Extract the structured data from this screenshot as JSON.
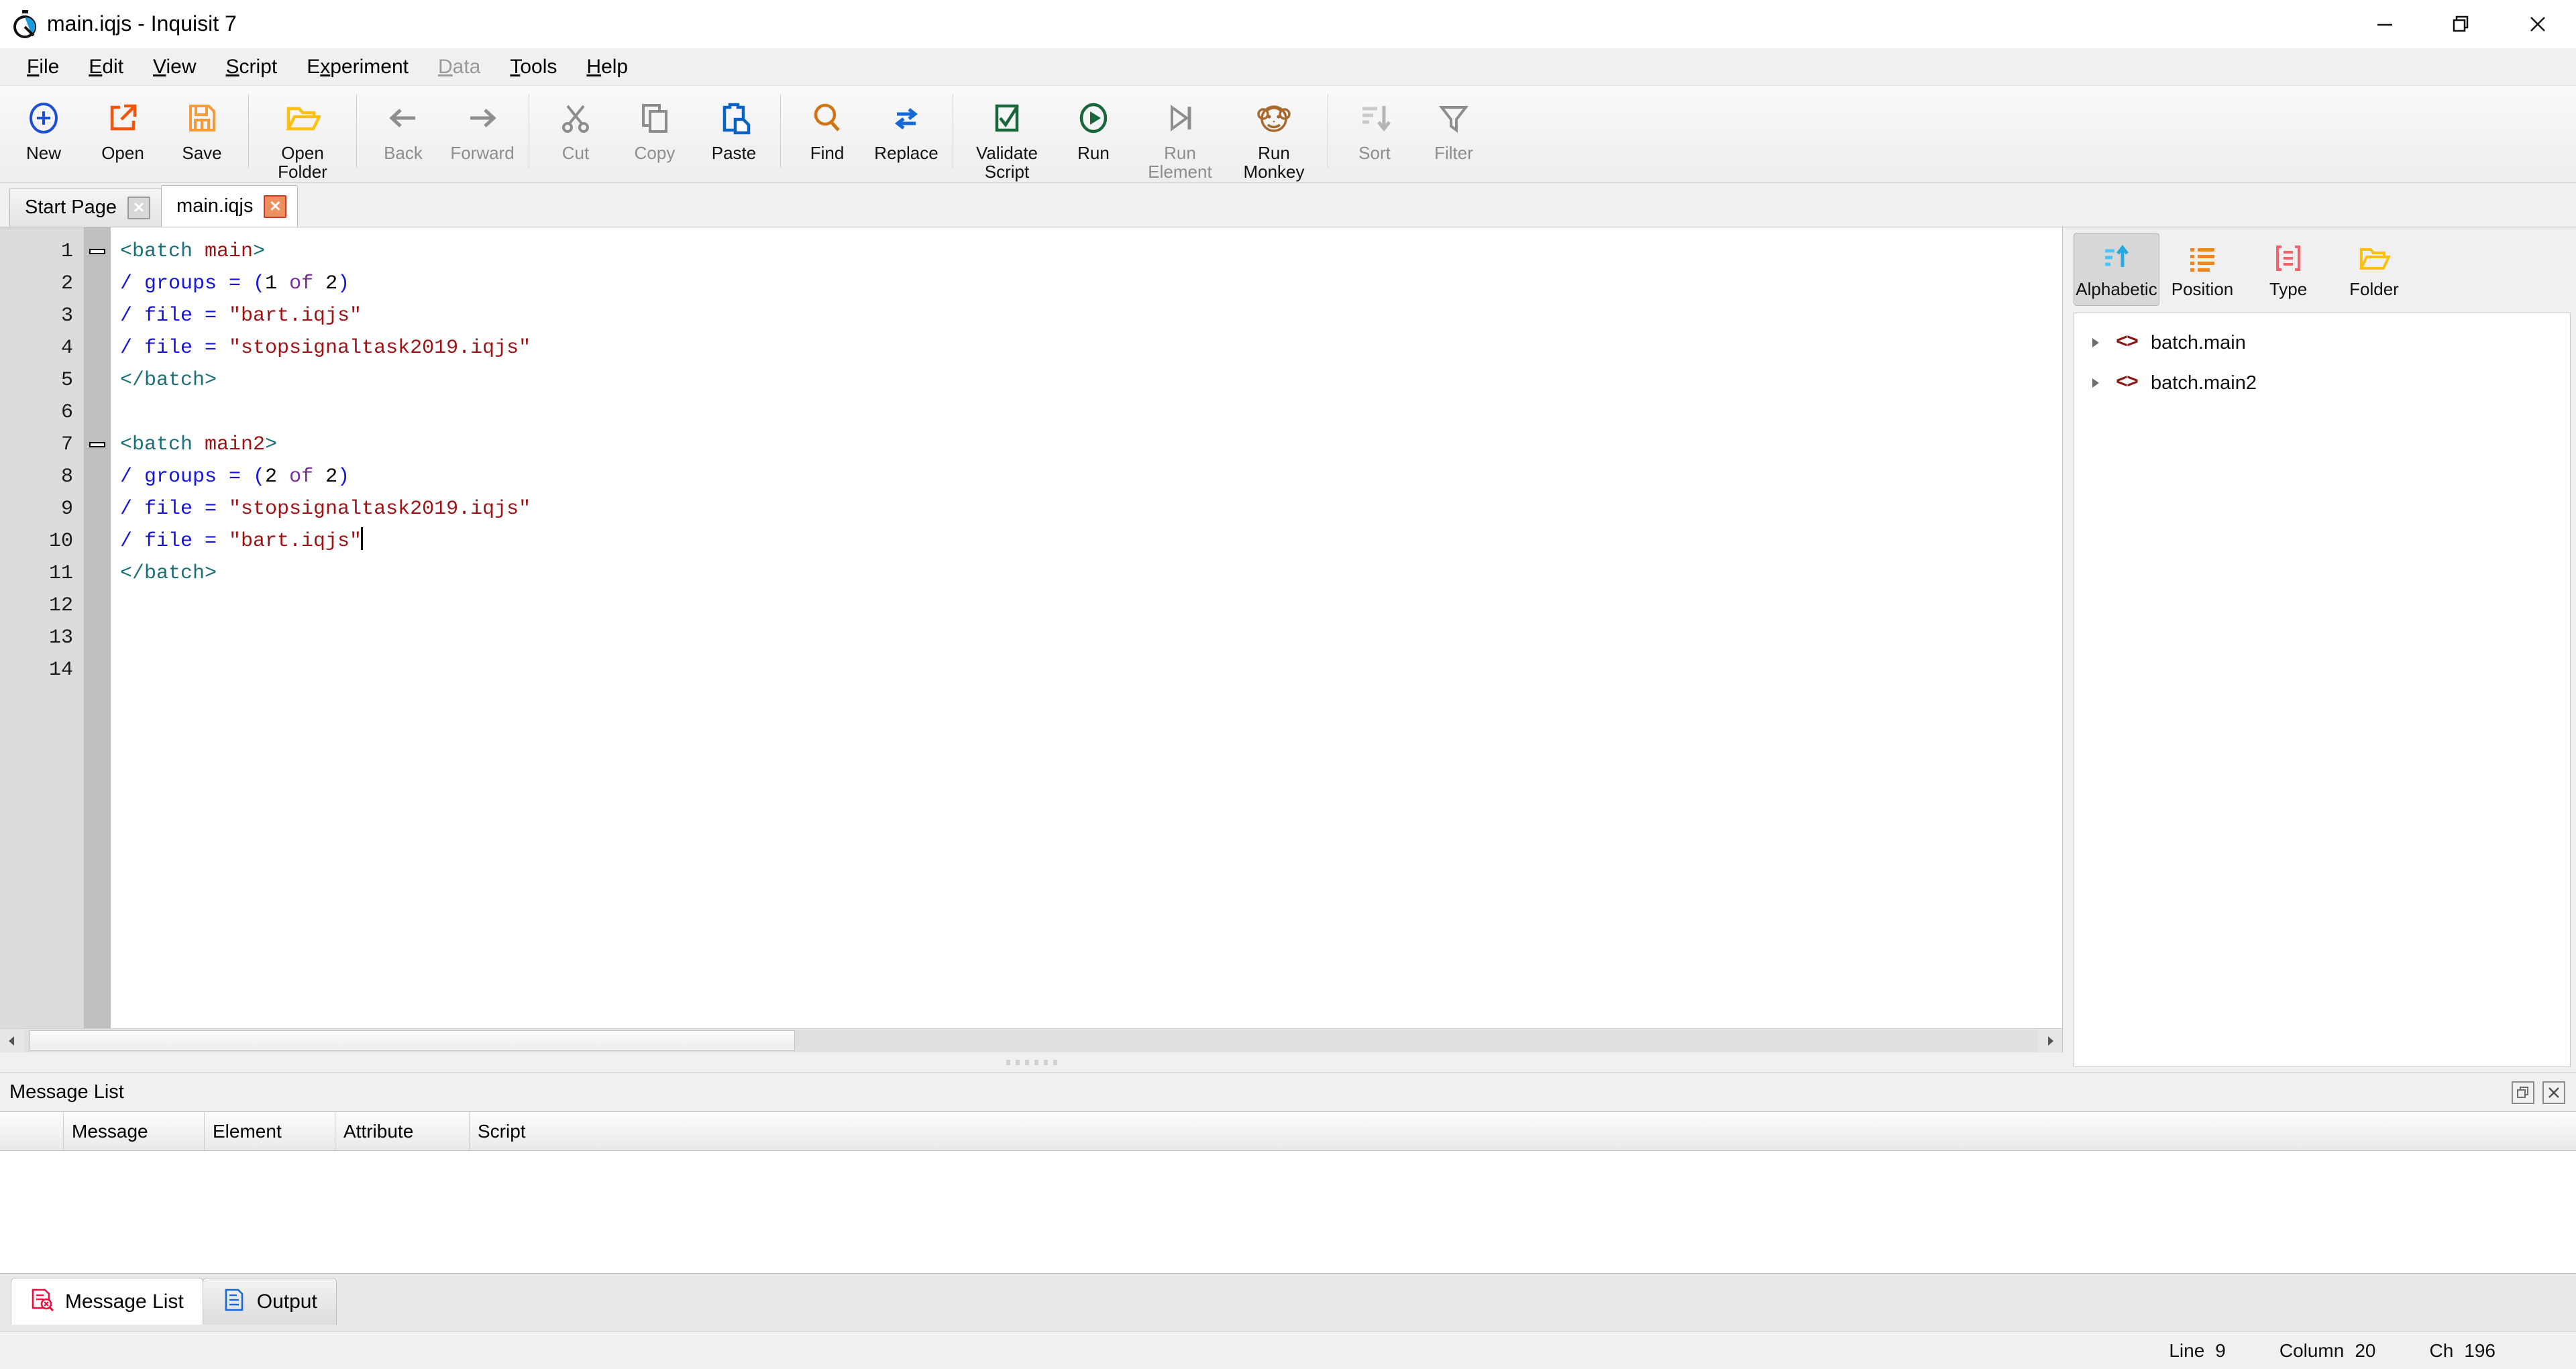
{
  "window": {
    "title": "main.iqjs - Inquisit 7",
    "app_icon": "stopwatch-icon",
    "controls": {
      "minimize": "minimize-icon",
      "restore": "restore-icon",
      "close": "close-icon"
    }
  },
  "menubar": {
    "items": [
      {
        "label": "File",
        "accel": "F",
        "enabled": true
      },
      {
        "label": "Edit",
        "accel": "E",
        "enabled": true
      },
      {
        "label": "View",
        "accel": "V",
        "enabled": true
      },
      {
        "label": "Script",
        "accel": "S",
        "enabled": true
      },
      {
        "label": "Experiment",
        "accel": "x",
        "enabled": true
      },
      {
        "label": "Data",
        "accel": "D",
        "enabled": false
      },
      {
        "label": "Tools",
        "accel": "T",
        "enabled": true
      },
      {
        "label": "Help",
        "accel": "H",
        "enabled": true
      }
    ]
  },
  "toolbar": {
    "buttons": [
      {
        "label": "New",
        "icon": "plus-circle-icon",
        "enabled": true
      },
      {
        "label": "Open",
        "icon": "open-external-icon",
        "enabled": true
      },
      {
        "label": "Save",
        "icon": "floppy-disk-icon",
        "enabled": true
      },
      {
        "label": "Open\nFolder",
        "icon": "folder-open-icon",
        "enabled": true
      },
      {
        "label": "Back",
        "icon": "arrow-left-icon",
        "enabled": false
      },
      {
        "label": "Forward",
        "icon": "arrow-right-icon",
        "enabled": false
      },
      {
        "label": "Cut",
        "icon": "scissors-icon",
        "enabled": false
      },
      {
        "label": "Copy",
        "icon": "copy-icon",
        "enabled": false
      },
      {
        "label": "Paste",
        "icon": "clipboard-paste-icon",
        "enabled": true
      },
      {
        "label": "Find",
        "icon": "magnifier-icon",
        "enabled": true
      },
      {
        "label": "Replace",
        "icon": "replace-arrows-icon",
        "enabled": true
      },
      {
        "label": "Validate\nScript",
        "icon": "checkbox-check-icon",
        "enabled": true
      },
      {
        "label": "Run",
        "icon": "play-circle-icon",
        "enabled": true
      },
      {
        "label": "Run\nElement",
        "icon": "play-to-end-icon",
        "enabled": false
      },
      {
        "label": "Run\nMonkey",
        "icon": "monkey-icon",
        "enabled": true
      },
      {
        "label": "Sort",
        "icon": "sort-descending-icon",
        "enabled": false
      },
      {
        "label": "Filter",
        "icon": "funnel-icon",
        "enabled": false
      }
    ]
  },
  "document_tabs": [
    {
      "label": "Start Page",
      "active": false,
      "close": "close-icon"
    },
    {
      "label": "main.iqjs",
      "active": true,
      "close": "close-icon"
    }
  ],
  "editor": {
    "line_numbers": [
      "1",
      "2",
      "3",
      "4",
      "5",
      "6",
      "7",
      "8",
      "9",
      "10",
      "11",
      "12",
      "13",
      "14"
    ],
    "lines": [
      {
        "n": 1,
        "fold": "collapse",
        "tokens": [
          {
            "t": "tag",
            "v": "<batch "
          },
          {
            "t": "name",
            "v": "main"
          },
          {
            "t": "tag",
            "v": ">"
          }
        ]
      },
      {
        "n": 2,
        "tokens": [
          {
            "t": "attr",
            "v": "/ groups = ("
          },
          {
            "t": "num",
            "v": "1"
          },
          {
            "t": "kw",
            "v": " of "
          },
          {
            "t": "num",
            "v": "2"
          },
          {
            "t": "attr",
            "v": ")"
          }
        ]
      },
      {
        "n": 3,
        "tokens": [
          {
            "t": "attr",
            "v": "/ file = "
          },
          {
            "t": "str",
            "v": "\"bart.iqjs\""
          }
        ]
      },
      {
        "n": 4,
        "tokens": [
          {
            "t": "attr",
            "v": "/ file = "
          },
          {
            "t": "str",
            "v": "\"stopsignaltask2019.iqjs\""
          }
        ]
      },
      {
        "n": 5,
        "tokens": [
          {
            "t": "tag",
            "v": "</batch>"
          }
        ]
      },
      {
        "n": 6,
        "tokens": []
      },
      {
        "n": 7,
        "fold": "collapse",
        "tokens": [
          {
            "t": "tag",
            "v": "<batch "
          },
          {
            "t": "name",
            "v": "main2"
          },
          {
            "t": "tag",
            "v": ">"
          }
        ]
      },
      {
        "n": 8,
        "tokens": [
          {
            "t": "attr",
            "v": "/ groups = ("
          },
          {
            "t": "num",
            "v": "2"
          },
          {
            "t": "kw",
            "v": " of "
          },
          {
            "t": "num",
            "v": "2"
          },
          {
            "t": "attr",
            "v": ")"
          }
        ]
      },
      {
        "n": 9,
        "tokens": [
          {
            "t": "attr",
            "v": "/ file = "
          },
          {
            "t": "str",
            "v": "\"stopsignaltask2019.iqjs\""
          }
        ]
      },
      {
        "n": 10,
        "caret": true,
        "tokens": [
          {
            "t": "attr",
            "v": "/ file = "
          },
          {
            "t": "str",
            "v": "\"bart.iqjs\""
          }
        ]
      },
      {
        "n": 11,
        "tokens": [
          {
            "t": "tag",
            "v": "</batch>"
          }
        ]
      },
      {
        "n": 12,
        "tokens": []
      },
      {
        "n": 13,
        "tokens": []
      },
      {
        "n": 14,
        "tokens": []
      }
    ]
  },
  "right_panel": {
    "view_buttons": [
      {
        "label": "Alphabetic",
        "icon": "sort-alpha-up-icon",
        "selected": true
      },
      {
        "label": "Position",
        "icon": "bullet-list-icon",
        "selected": false
      },
      {
        "label": "Type",
        "icon": "brackets-list-icon",
        "selected": false
      },
      {
        "label": "Folder",
        "icon": "folder-open-icon",
        "selected": false
      }
    ],
    "tree": [
      {
        "label": "batch.main",
        "icon": "code-brackets-icon",
        "arrow": "triangle-right-icon",
        "expanded": false
      },
      {
        "label": "batch.main2",
        "icon": "code-brackets-icon",
        "arrow": "triangle-right-icon",
        "expanded": false
      }
    ]
  },
  "message_panel": {
    "title": "Message List",
    "header_buttons": [
      {
        "icon": "float-window-icon"
      },
      {
        "icon": "close-icon"
      }
    ],
    "columns": [
      "",
      "Message",
      "Element",
      "Attribute",
      "Script"
    ],
    "rows": []
  },
  "bottom_tabs": [
    {
      "label": "Message List",
      "icon": "message-list-icon",
      "active": true
    },
    {
      "label": "Output",
      "icon": "output-document-icon",
      "active": false
    }
  ],
  "statusbar": {
    "line_label": "Line",
    "line_value": "9",
    "column_label": "Column",
    "column_value": "20",
    "ch_label": "Ch",
    "ch_value": "196"
  },
  "colors": {
    "tag": "#1d6f79",
    "name": "#9d1212",
    "attr": "#1414e0",
    "string": "#9d1212",
    "keyword": "#7d2a9e",
    "accent_orange": "#e8710a"
  }
}
